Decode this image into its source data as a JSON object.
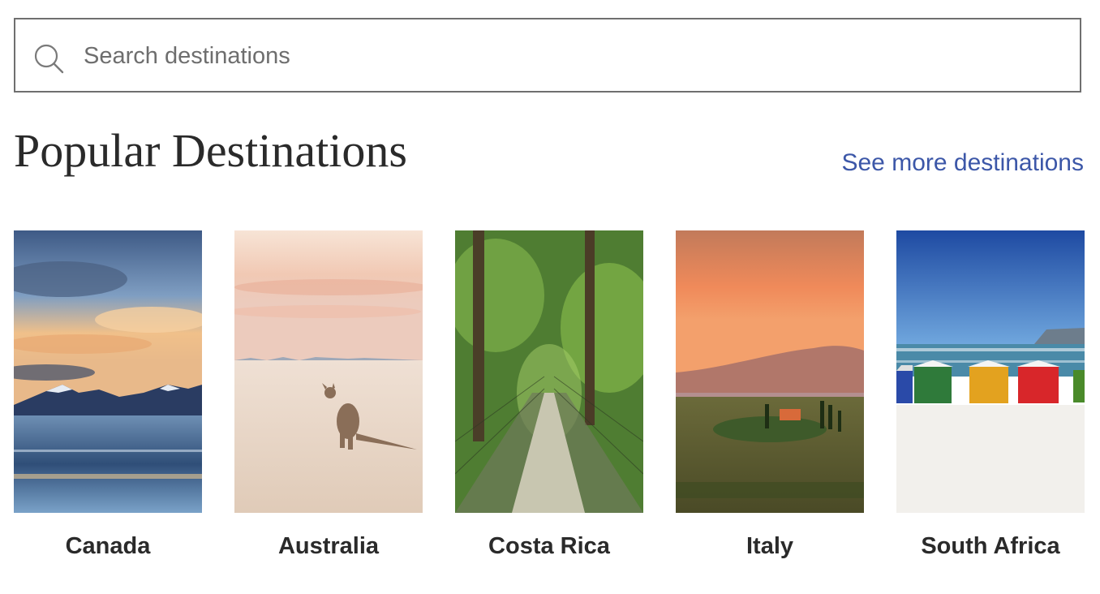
{
  "search": {
    "placeholder": "Search destinations",
    "icon": "search-icon"
  },
  "section": {
    "title": "Popular Destinations",
    "see_more": "See more destinations"
  },
  "destinations": [
    {
      "name": "Canada",
      "image": "mountain-lake-sunset"
    },
    {
      "name": "Australia",
      "image": "kangaroo-on-beach"
    },
    {
      "name": "Costa Rica",
      "image": "rainforest-hanging-bridge"
    },
    {
      "name": "Italy",
      "image": "tuscan-hills-villa"
    },
    {
      "name": "South Africa",
      "image": "colorful-beach-huts"
    }
  ],
  "colors": {
    "link": "#3c57a8",
    "text": "#2a2a2a",
    "border": "#6f6f6f"
  }
}
